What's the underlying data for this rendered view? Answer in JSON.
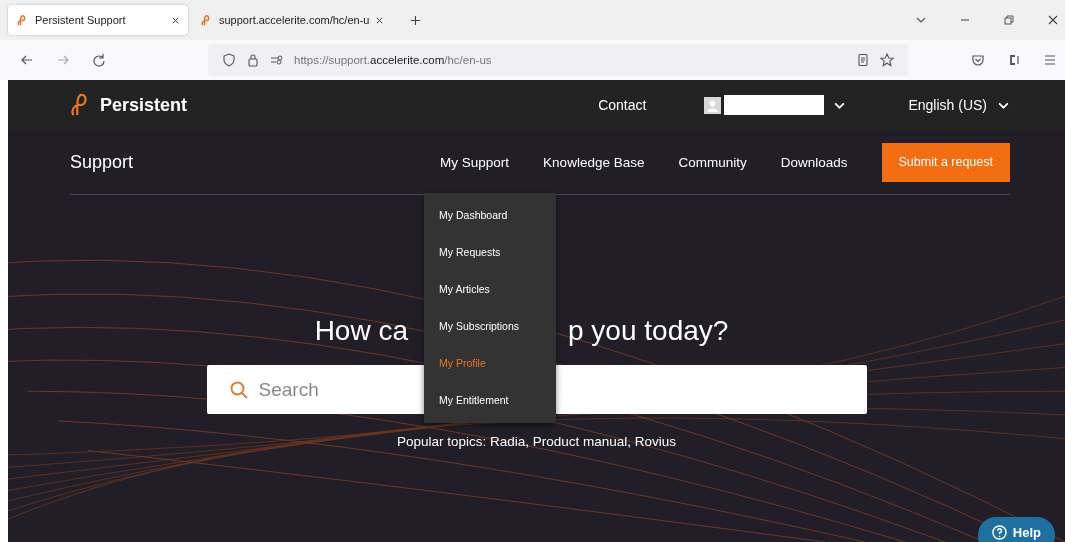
{
  "browser": {
    "tabs": [
      {
        "title": "Persistent Support",
        "selected": true
      },
      {
        "title": "support.accelerite.com/hc/en-u",
        "selected": false
      }
    ],
    "url_host_prefix": "https://support.",
    "url_domain": "accelerite.com",
    "url_path": "/hc/en-us"
  },
  "header": {
    "brand": "Persistent",
    "contact": "Contact",
    "language": "English (US)"
  },
  "subnav": {
    "title": "Support",
    "items": [
      {
        "label": "My Support",
        "menu": [
          {
            "label": "My Dashboard",
            "selected": false
          },
          {
            "label": "My Requests",
            "selected": false
          },
          {
            "label": "My Articles",
            "selected": false
          },
          {
            "label": "My Subscriptions",
            "selected": false
          },
          {
            "label": "My Profile",
            "selected": true
          },
          {
            "label": "My Entitlement",
            "selected": false
          }
        ]
      },
      {
        "label": "Knowledge Base"
      },
      {
        "label": "Community"
      },
      {
        "label": "Downloads"
      }
    ],
    "cta": "Submit a request"
  },
  "hero": {
    "heading_parts": [
      "How ca",
      "p you today?"
    ],
    "search": {
      "placeholder": "Search"
    },
    "popular": "Popular topics: Radia, Product manual, Rovius"
  },
  "help_button": "Help"
}
